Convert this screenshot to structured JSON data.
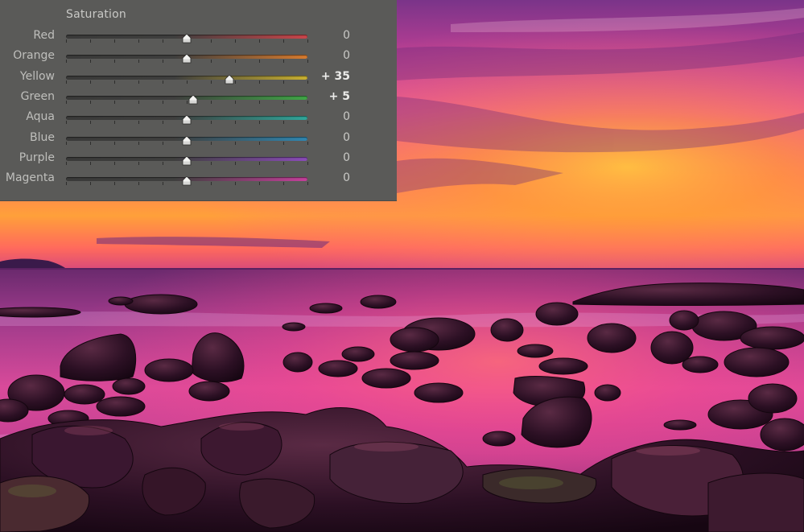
{
  "panel": {
    "title": "Saturation",
    "colors": {
      "background": "#5a5a58",
      "text": "#c9c9c6"
    },
    "range": [
      -100,
      100
    ],
    "sliders": [
      {
        "id": "red",
        "label": "Red",
        "value": 0,
        "display": "0",
        "color": "#c9454a"
      },
      {
        "id": "orange",
        "label": "Orange",
        "value": 0,
        "display": "0",
        "color": "#d67a2e"
      },
      {
        "id": "yellow",
        "label": "Yellow",
        "value": 35,
        "display": "+ 35",
        "color": "#c9b030"
      },
      {
        "id": "green",
        "label": "Green",
        "value": 5,
        "display": "+ 5",
        "color": "#3fa646"
      },
      {
        "id": "aqua",
        "label": "Aqua",
        "value": 0,
        "display": "0",
        "color": "#2fa69a"
      },
      {
        "id": "blue",
        "label": "Blue",
        "value": 0,
        "display": "0",
        "color": "#2f86b0"
      },
      {
        "id": "purple",
        "label": "Purple",
        "value": 0,
        "display": "0",
        "color": "#8a4bb8"
      },
      {
        "id": "magenta",
        "label": "Magenta",
        "value": 0,
        "display": "0",
        "color": "#c43f9a"
      }
    ]
  },
  "photo": {
    "subject": "sunset-seascape-rocks",
    "colors": {
      "sky_top": "#8a3c8e",
      "sky_glow": "#ff8a2a",
      "sea": "#b8317e",
      "rock": "#2a0f22"
    }
  }
}
